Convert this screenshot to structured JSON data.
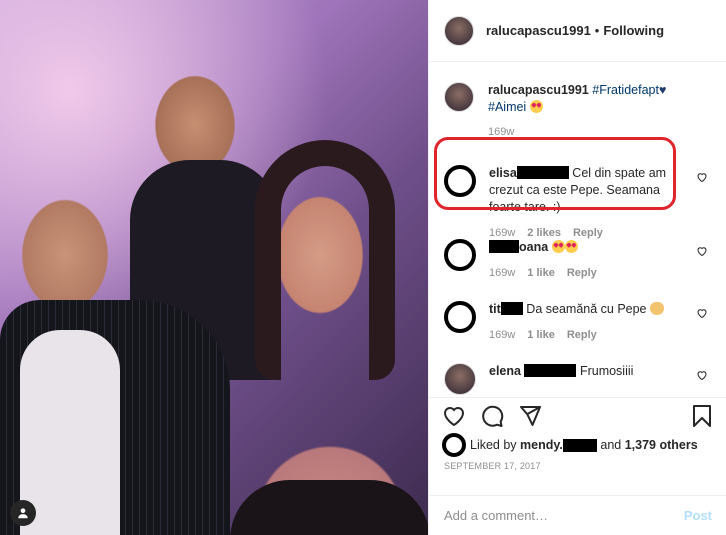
{
  "post": {
    "username": "ralucapascu1991",
    "follow_label": "Following",
    "separator": "•"
  },
  "caption": {
    "username": "ralucapascu1991",
    "hashtag1": "#Fratidefapt",
    "hashtag2": "#Aimei",
    "time": "169w"
  },
  "comments": [
    {
      "user_prefix": "elisa",
      "text": "Cel din spate am crezut ca este Pepe. Seamana foarte tare. :)",
      "time": "169w",
      "likes": "2 likes",
      "reply": "Reply"
    },
    {
      "user_suffix": "oana",
      "text": "",
      "time": "169w",
      "likes": "1 like",
      "reply": "Reply"
    },
    {
      "user_prefix": "tit",
      "text": "Da seamănă cu Pepe",
      "time": "169w",
      "likes": "1 like",
      "reply": "Reply"
    },
    {
      "user_prefix": "elena",
      "text": "Frumosiiii"
    }
  ],
  "likes": {
    "prefix": "Liked by",
    "user": "mendy.",
    "and": "and",
    "others": "1,379 others"
  },
  "date": "SEPTEMBER 17, 2017",
  "add_comment": {
    "placeholder": "Add a comment…",
    "post_label": "Post"
  },
  "colors": {
    "highlight_box": "#e0242b",
    "hashtag": "#00376b",
    "post_button": "#b2dffc"
  }
}
